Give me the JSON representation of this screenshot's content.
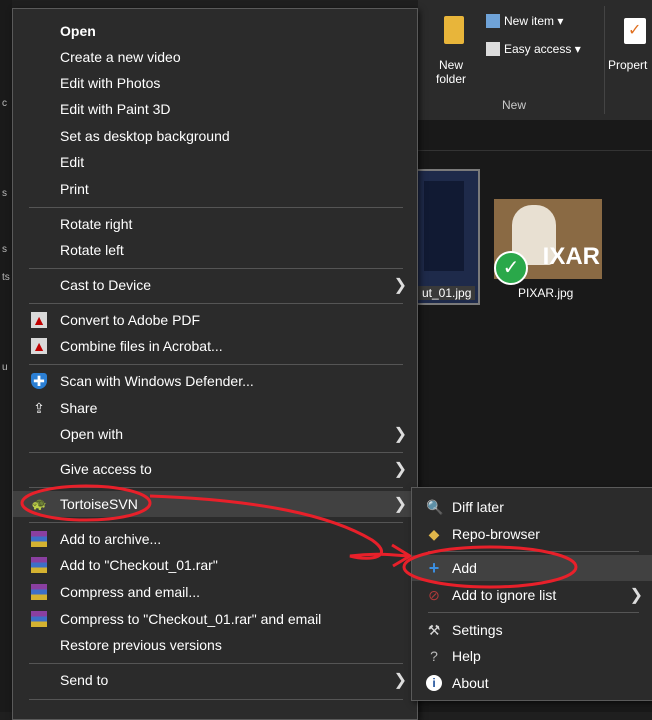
{
  "ribbon": {
    "new_folder": "New\nfolder",
    "new_item": "New item ▾",
    "easy_access": "Easy access ▾",
    "properties": "Propert",
    "group_new": "New"
  },
  "files": [
    {
      "label": "ut_01.jpg"
    },
    {
      "label": "PIXAR.jpg",
      "thumb_text": "IXAR"
    }
  ],
  "context_menu": {
    "items": [
      {
        "label": "Open",
        "bold": true
      },
      {
        "label": "Create a new video"
      },
      {
        "label": "Edit with Photos"
      },
      {
        "label": "Edit with Paint 3D"
      },
      {
        "label": "Set as desktop background"
      },
      {
        "label": "Edit"
      },
      {
        "label": "Print"
      },
      {
        "label": "Rotate right"
      },
      {
        "label": "Rotate left"
      },
      {
        "label": "Cast to Device"
      },
      {
        "label": "Convert to Adobe PDF"
      },
      {
        "label": "Combine files in Acrobat..."
      },
      {
        "label": "Scan with Windows Defender..."
      },
      {
        "label": "Share"
      },
      {
        "label": "Open with"
      },
      {
        "label": "Give access to"
      },
      {
        "label": "TortoiseSVN"
      },
      {
        "label": "Add to archive..."
      },
      {
        "label": "Add to \"Checkout_01.rar\""
      },
      {
        "label": "Compress and email..."
      },
      {
        "label": "Compress to \"Checkout_01.rar\" and email"
      },
      {
        "label": "Restore previous versions"
      },
      {
        "label": "Send to"
      }
    ]
  },
  "submenu": {
    "items": [
      {
        "label": "Diff later"
      },
      {
        "label": "Repo-browser"
      },
      {
        "label": "Add"
      },
      {
        "label": "Add to ignore list"
      },
      {
        "label": "Settings"
      },
      {
        "label": "Help"
      },
      {
        "label": "About"
      }
    ]
  },
  "colors": {
    "annotation": "#e8202a",
    "menu_bg": "#2b2b2b",
    "highlight": "#414141"
  }
}
